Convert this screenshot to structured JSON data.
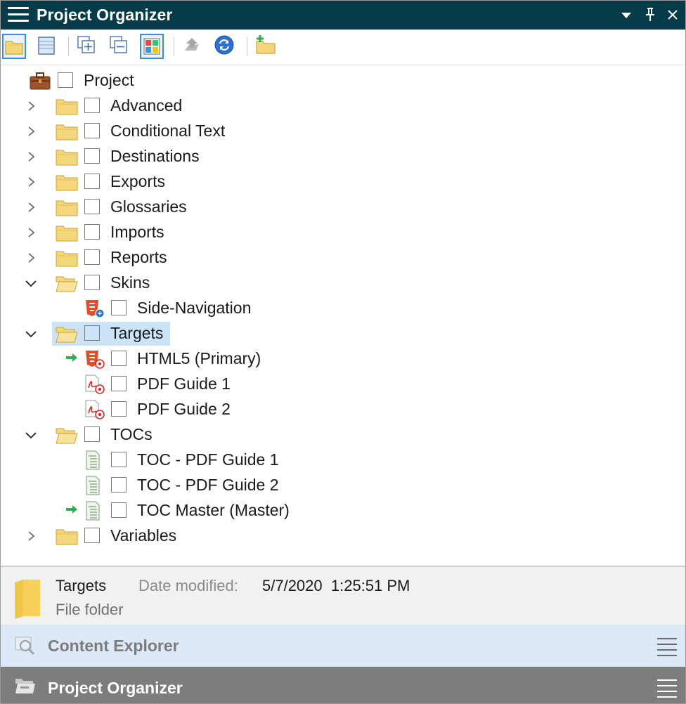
{
  "window": {
    "title": "Project Organizer",
    "title_bar_color": "#063b4a"
  },
  "toolbar": {
    "buttons": [
      {
        "icon": "folder-view-icon",
        "selected": true
      },
      {
        "icon": "list-view-icon",
        "selected": false
      },
      {
        "icon": "expand-all-icon",
        "selected": false
      },
      {
        "icon": "collapse-all-icon",
        "selected": false
      },
      {
        "icon": "color-grid-icon",
        "selected": true
      },
      {
        "icon": "up-arrow-icon",
        "selected": false,
        "disabled": true
      },
      {
        "icon": "refresh-icon",
        "selected": false
      },
      {
        "icon": "new-folder-icon",
        "selected": false
      }
    ]
  },
  "tree": {
    "items": [
      {
        "label": "Project",
        "icon": "project-briefcase-icon",
        "expander": "none",
        "level": 0
      },
      {
        "label": "Advanced",
        "icon": "folder-icon",
        "expander": "collapsed",
        "level": 1
      },
      {
        "label": "Conditional Text",
        "icon": "folder-icon",
        "expander": "collapsed",
        "level": 1
      },
      {
        "label": "Destinations",
        "icon": "folder-icon",
        "expander": "collapsed",
        "level": 1
      },
      {
        "label": "Exports",
        "icon": "folder-icon",
        "expander": "collapsed",
        "level": 1
      },
      {
        "label": "Glossaries",
        "icon": "folder-icon",
        "expander": "collapsed",
        "level": 1
      },
      {
        "label": "Imports",
        "icon": "folder-icon",
        "expander": "collapsed",
        "level": 1
      },
      {
        "label": "Reports",
        "icon": "folder-icon",
        "expander": "collapsed",
        "level": 1
      },
      {
        "label": "Skins",
        "icon": "open-folder-icon",
        "expander": "expanded",
        "level": 1
      },
      {
        "label": "Side-Navigation",
        "icon": "html5-skin-icon",
        "expander": "none",
        "level": 2
      },
      {
        "label": "Targets",
        "icon": "open-folder-icon",
        "expander": "expanded",
        "level": 1,
        "selected": true
      },
      {
        "label": "HTML5 (Primary)",
        "icon": "html5-target-icon",
        "expander": "none",
        "level": 2,
        "primary": true
      },
      {
        "label": "PDF Guide 1",
        "icon": "pdf-target-icon",
        "expander": "none",
        "level": 2
      },
      {
        "label": "PDF Guide 2",
        "icon": "pdf-target-icon",
        "expander": "none",
        "level": 2
      },
      {
        "label": "TOCs",
        "icon": "open-folder-icon",
        "expander": "expanded",
        "level": 1
      },
      {
        "label": "TOC - PDF Guide 1",
        "icon": "toc-file-icon",
        "expander": "none",
        "level": 2
      },
      {
        "label": "TOC - PDF Guide 2",
        "icon": "toc-file-icon",
        "expander": "none",
        "level": 2
      },
      {
        "label": "TOC Master (Master)",
        "icon": "toc-file-icon",
        "expander": "none",
        "level": 2,
        "primary": true
      },
      {
        "label": "Variables",
        "icon": "folder-icon",
        "expander": "collapsed",
        "level": 1
      }
    ]
  },
  "info": {
    "name": "Targets",
    "type": "File folder",
    "date_label": "Date modified:",
    "date_value": "5/7/2020  1:25:51 PM"
  },
  "tabs": {
    "content_explorer": "Content Explorer",
    "project_organizer": "Project Organizer"
  },
  "colors": {
    "selection": "#cce4f7",
    "folder": "#f5d77b",
    "accent_blue": "#3a8ed8",
    "html5_red": "#e44d26",
    "primary_arrow": "#2bb24c"
  }
}
